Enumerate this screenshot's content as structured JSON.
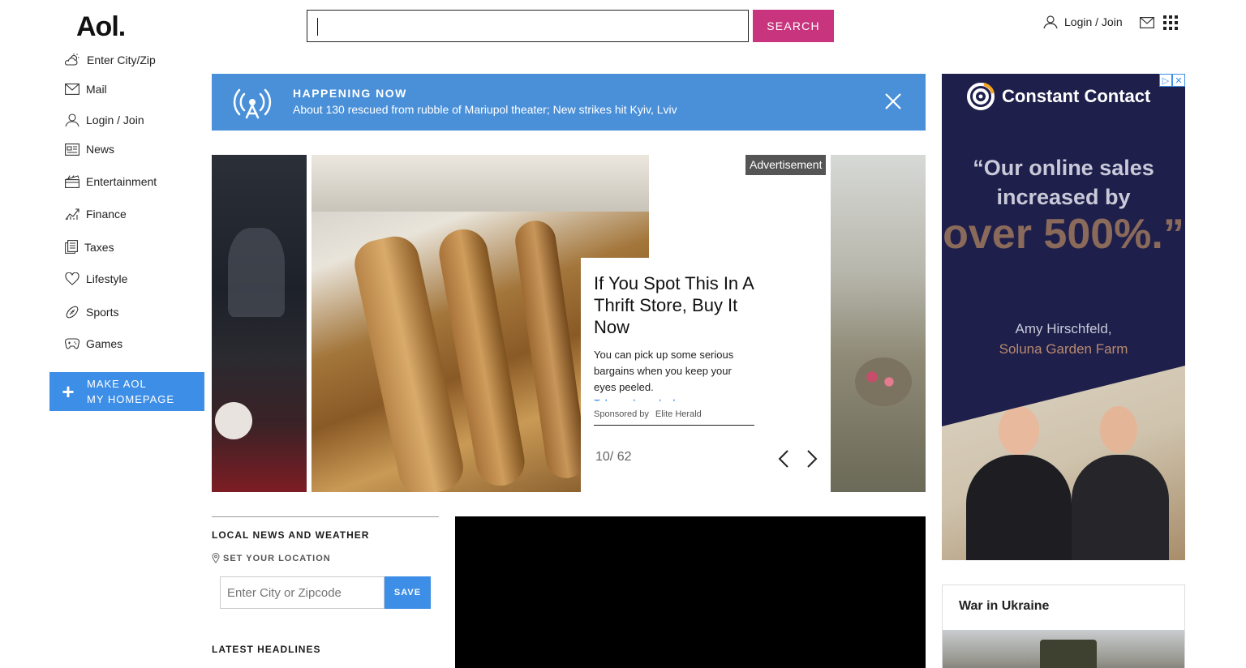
{
  "header": {
    "logo": "Aol.",
    "search_placeholder": "",
    "search_button": "SEARCH",
    "login": "Login / Join"
  },
  "sidebar": {
    "items": [
      {
        "label": "Enter City/Zip",
        "icon": "weather-icon"
      },
      {
        "label": "Mail",
        "icon": "mail-icon"
      },
      {
        "label": "Login / Join",
        "icon": "user-icon"
      },
      {
        "label": "News",
        "icon": "news-icon"
      },
      {
        "label": "Entertainment",
        "icon": "clapperboard-icon"
      },
      {
        "label": "Finance",
        "icon": "chart-icon"
      },
      {
        "label": "Taxes",
        "icon": "document-icon"
      },
      {
        "label": "Lifestyle",
        "icon": "heart-icon"
      },
      {
        "label": "Sports",
        "icon": "football-icon"
      },
      {
        "label": "Games",
        "icon": "gamepad-icon"
      }
    ],
    "homepage_line1": "MAKE AOL",
    "homepage_line2": "MY HOMEPAGE"
  },
  "banner": {
    "label": "HAPPENING NOW",
    "headline": "About 130 rescued from rubble of Mariupol theater; New strikes hit Kyiv, Lviv"
  },
  "carousel": {
    "ad_tag": "Advertisement",
    "title": "If You Spot This In A Thrift Store, Buy It Now",
    "body": "You can pick up some serious bargains when you keep your eyes peeled.",
    "more": "Take a closer look",
    "sponsored_by": "Sponsored by",
    "sponsor": "Elite Herald",
    "counter": "10/ 62"
  },
  "local": {
    "title": "LOCAL NEWS AND WEATHER",
    "set_location": "SET YOUR LOCATION",
    "zip_placeholder": "Enter City or Zipcode",
    "save": "SAVE",
    "latest": "LATEST HEADLINES"
  },
  "right_ad": {
    "brand": "Constant Contact",
    "quote": "“Our online sales increased by",
    "big": "over 500%.”",
    "name": "Amy Hirschfeld,",
    "farm": "Soluna Garden Farm"
  },
  "war": {
    "title": "War in Ukraine"
  },
  "colors": {
    "search_button": "#c8347e",
    "banner": "#4a90d9",
    "accent_blue": "#3d8ee6",
    "ad_bg": "#1e1f4b"
  }
}
